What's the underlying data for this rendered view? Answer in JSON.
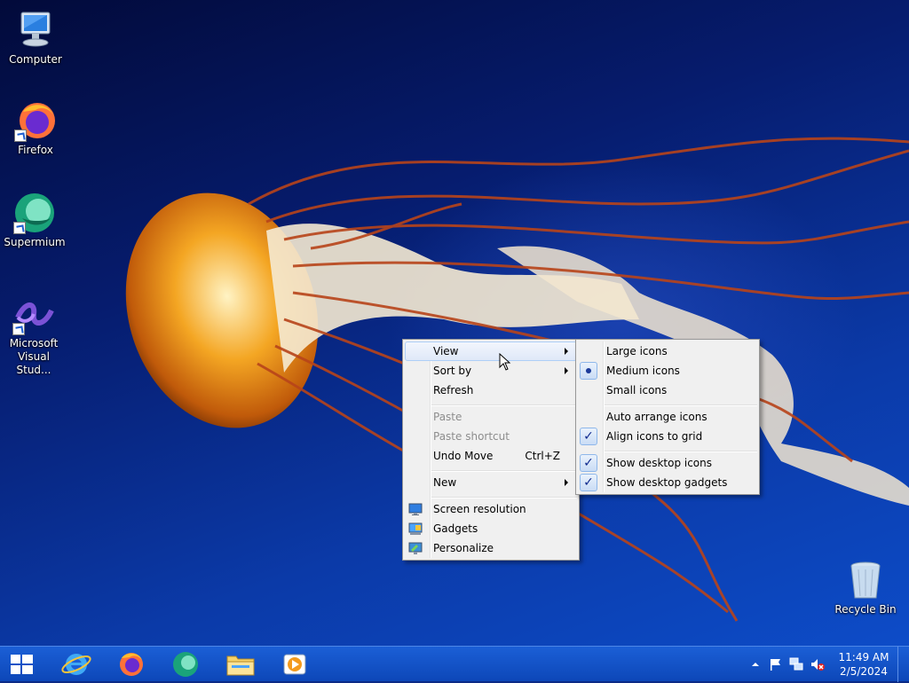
{
  "desktop": {
    "icons": [
      {
        "label": "Computer",
        "icon": "computer-icon"
      },
      {
        "label": "Firefox",
        "icon": "firefox-icon"
      },
      {
        "label": "Supermium",
        "icon": "supermium-icon"
      },
      {
        "label": "Microsoft Visual Stud...",
        "icon": "visual-studio-icon"
      },
      {
        "label": "Recycle Bin",
        "icon": "recycle-bin-icon"
      }
    ]
  },
  "context_menu": {
    "items": [
      {
        "label": "View",
        "submenu": true,
        "state": "highlighted"
      },
      {
        "label": "Sort by",
        "submenu": true
      },
      {
        "label": "Refresh"
      },
      {
        "label": "Paste",
        "disabled": true
      },
      {
        "label": "Paste shortcut",
        "disabled": true
      },
      {
        "label": "Undo Move",
        "shortcut": "Ctrl+Z"
      },
      {
        "label": "New",
        "submenu": true
      },
      {
        "label": "Screen resolution",
        "icon": "screen-resolution-icon"
      },
      {
        "label": "Gadgets",
        "icon": "gadgets-icon"
      },
      {
        "label": "Personalize",
        "icon": "personalize-icon"
      }
    ]
  },
  "view_submenu": {
    "items": [
      {
        "label": "Large icons"
      },
      {
        "label": "Medium icons",
        "selected": true
      },
      {
        "label": "Small icons"
      },
      {
        "label": "Auto arrange icons"
      },
      {
        "label": "Align icons to grid",
        "checked": true
      },
      {
        "label": "Show desktop icons",
        "checked": true
      },
      {
        "label": "Show desktop gadgets",
        "checked": true
      }
    ]
  },
  "taskbar": {
    "pinned": [
      "start-button",
      "internet-explorer-icon",
      "firefox-icon",
      "supermium-icon",
      "file-explorer-icon",
      "media-player-icon"
    ],
    "tray": [
      "show-hidden-icons",
      "action-center-flag-icon",
      "network-icon",
      "volume-muted-icon"
    ],
    "clock": {
      "time": "11:49 AM",
      "date": "2/5/2024"
    }
  },
  "colors": {
    "taskbar": "#1b5fd6",
    "menu_bg": "#f0f0f0",
    "highlight": "#dfe8f8",
    "desktop": "#0b2a86"
  }
}
